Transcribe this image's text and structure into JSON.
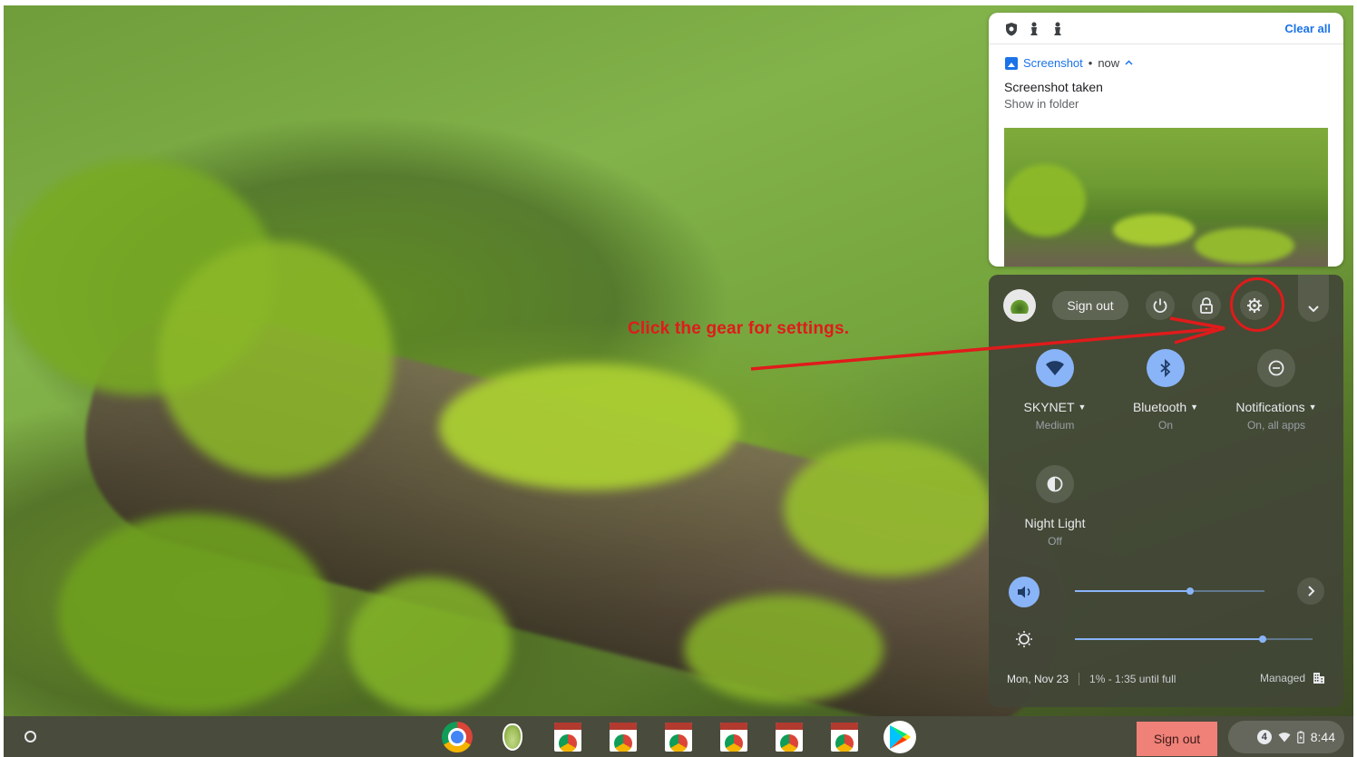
{
  "notification": {
    "clear_all": "Clear all",
    "app_name": "Screenshot",
    "separator": "•",
    "time": "now",
    "caret": "^",
    "title": "Screenshot taken",
    "subtitle": "Show in folder"
  },
  "quick_settings": {
    "sign_out": "Sign out",
    "tiles": [
      {
        "label": "SKYNET",
        "sub": "Medium",
        "icon": "wifi-icon",
        "state": "on"
      },
      {
        "label": "Bluetooth",
        "sub": "On",
        "icon": "bluetooth-icon",
        "state": "on"
      },
      {
        "label": "Notifications",
        "sub": "On, all apps",
        "icon": "do-not-disturb-icon",
        "state": "off"
      },
      {
        "label": "Night Light",
        "sub": "Off",
        "icon": "night-light-icon",
        "state": "off"
      }
    ],
    "volume_level": 0.61,
    "brightness_level": 0.79,
    "date": "Mon, Nov 23",
    "battery": "1% - 1:35 until full",
    "managed": "Managed"
  },
  "annotation": {
    "text": "Click the gear for settings.",
    "color": "#e01b1b"
  },
  "shelf": {
    "apps": [
      "chrome-icon",
      "pear-deck-icon",
      "web-app-icon",
      "web-app-icon",
      "web-app-icon",
      "web-app-icon",
      "web-app-icon",
      "web-app-icon",
      "play-store-icon"
    ],
    "sign_out": "Sign out",
    "notification_count": "4",
    "time": "8:44"
  },
  "colors": {
    "accent": "#8ab4f8",
    "link": "#1a73e8",
    "sign_out_bg": "#f08178"
  }
}
